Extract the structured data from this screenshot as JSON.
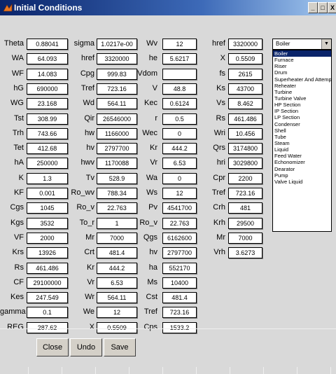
{
  "window": {
    "title": "Initial Conditions",
    "controls": [
      "_",
      "□",
      "X"
    ]
  },
  "columns": [
    [
      {
        "label": "Theta",
        "value": "0.88041"
      },
      {
        "label": "WA",
        "value": "64.093"
      },
      {
        "label": "WF",
        "value": "14.083"
      },
      {
        "label": "hG",
        "value": "690000"
      },
      {
        "label": "WG",
        "value": "23.168"
      },
      {
        "label": "Tst",
        "value": "308.99"
      },
      {
        "label": "Trh",
        "value": "743.66"
      },
      {
        "label": "Tet",
        "value": "412.68"
      },
      {
        "label": "hA",
        "value": "250000"
      },
      {
        "label": "K",
        "value": "1.3"
      },
      {
        "label": "KF",
        "value": "0.001"
      },
      {
        "label": "Cgs",
        "value": "1045"
      },
      {
        "label": "Kgs",
        "value": "3532"
      },
      {
        "label": "VF",
        "value": "2000"
      },
      {
        "label": "Krs",
        "value": "13926"
      },
      {
        "label": "Rs",
        "value": "461.486"
      },
      {
        "label": "CF",
        "value": "29100000"
      },
      {
        "label": "Kes",
        "value": "247.549"
      },
      {
        "label": "gamma",
        "value": "0.1"
      },
      {
        "label": "REG",
        "value": "287.62"
      }
    ],
    [
      {
        "label": "sigma",
        "value": "1.0217e-00"
      },
      {
        "label": "href",
        "value": "3320000"
      },
      {
        "label": "Cpg",
        "value": "999.83"
      },
      {
        "label": "Tref",
        "value": "723.16"
      },
      {
        "label": "Wd",
        "value": "564.11"
      },
      {
        "label": "Qir",
        "value": "26546000"
      },
      {
        "label": "hw",
        "value": "1166000"
      },
      {
        "label": "hv",
        "value": "2797700"
      },
      {
        "label": "hwv",
        "value": "1170088"
      },
      {
        "label": "Tv",
        "value": "528.9"
      },
      {
        "label": "Ro_wv",
        "value": "788.34"
      },
      {
        "label": "Ro_v",
        "value": "22.763"
      },
      {
        "label": "To_r",
        "value": "1"
      },
      {
        "label": "Mr",
        "value": "7000"
      },
      {
        "label": "Crt",
        "value": "481.4"
      },
      {
        "label": "Kr",
        "value": "444.2"
      },
      {
        "label": "Vr",
        "value": "6.53"
      },
      {
        "label": "Wr",
        "value": "564.11"
      },
      {
        "label": "We",
        "value": "12"
      },
      {
        "label": "X",
        "value": "0.5509"
      }
    ],
    [
      {
        "label": "Wv",
        "value": "12"
      },
      {
        "label": "he",
        "value": "5.6217"
      },
      {
        "label": "Vdom",
        "value": ""
      },
      {
        "label": "V",
        "value": "48.8"
      },
      {
        "label": "Kec",
        "value": "0.6124"
      },
      {
        "label": "r",
        "value": "0.5"
      },
      {
        "label": "Wec",
        "value": "0"
      },
      {
        "label": "Kr",
        "value": "444.2"
      },
      {
        "label": "Vr",
        "value": "6.53"
      },
      {
        "label": "Wa",
        "value": "0"
      },
      {
        "label": "Ws",
        "value": "12"
      },
      {
        "label": "Pv",
        "value": "4541700"
      },
      {
        "label": "Ro_v",
        "value": "22.763"
      },
      {
        "label": "Qgs",
        "value": "6162600"
      },
      {
        "label": "hv",
        "value": "2797700"
      },
      {
        "label": "ha",
        "value": "552170"
      },
      {
        "label": "Ms",
        "value": "10400"
      },
      {
        "label": "Cst",
        "value": "481.4"
      },
      {
        "label": "Tref",
        "value": "723.16"
      },
      {
        "label": "Cps",
        "value": "1533.2"
      }
    ],
    [
      {
        "label": "href",
        "value": "3320000"
      },
      {
        "label": "X",
        "value": "0.5509"
      },
      {
        "label": "fs",
        "value": "2615"
      },
      {
        "label": "Ks",
        "value": "43700"
      },
      {
        "label": "Vs",
        "value": "8.462"
      },
      {
        "label": "Rs",
        "value": "461.486"
      },
      {
        "label": "Wri",
        "value": "10.456"
      },
      {
        "label": "Qrs",
        "value": "3174800"
      },
      {
        "label": "hri",
        "value": "3029800"
      },
      {
        "label": "Cpr",
        "value": "2200"
      },
      {
        "label": "Tref",
        "value": "723.16"
      },
      {
        "label": "Crh",
        "value": "481"
      },
      {
        "label": "Krh",
        "value": "29500"
      },
      {
        "label": "Mr",
        "value": "7000"
      },
      {
        "label": "Vrh",
        "value": "3.6273"
      }
    ]
  ],
  "component_select": {
    "selected": "Boiler",
    "options": [
      "Boiler",
      "Furnace",
      "Riser",
      "Drum",
      "Superheater And Attemperator",
      "Reheater",
      "Turbine",
      "Turbine Valve",
      "HP Section",
      "IP Section",
      "LP Section",
      "Condenser",
      "Shell",
      "Tube",
      "Steam",
      "Liquid",
      "Feed Water",
      "Echonomizer",
      "Dearator",
      "Pump",
      "Valve Liquid"
    ]
  },
  "buttons": {
    "close": "Close",
    "undo": "Undo",
    "save": "Save"
  },
  "colors": {
    "titlebar": "#0a246a",
    "background": "#d9d9d9",
    "selection": "#0a246a"
  }
}
